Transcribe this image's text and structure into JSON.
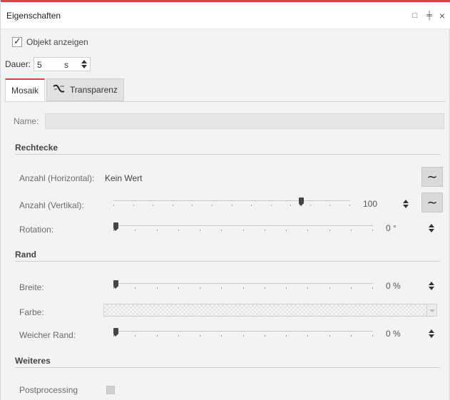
{
  "window": {
    "title": "Eigenschaften",
    "controls": [
      {
        "name": "maximize",
        "glyph": "□"
      },
      {
        "name": "pin",
        "glyph": "╪"
      },
      {
        "name": "close",
        "glyph": "×"
      }
    ]
  },
  "accent_color": "#d94545",
  "show_object": {
    "label": "Objekt anzeigen",
    "checked": true
  },
  "duration": {
    "label": "Dauer:",
    "value": "5",
    "unit": "s"
  },
  "tabs": [
    {
      "label": "Mosaik",
      "active": true,
      "icon": ""
    },
    {
      "label": "Transparenz",
      "active": false,
      "icon": "transparency-icon"
    }
  ],
  "name_field": {
    "label": "Name:",
    "value": ""
  },
  "sections": {
    "rechtecke": {
      "title": "Rechtecke",
      "horizontal": {
        "label": "Anzahl (Horizontal):",
        "value": "Kein Wert"
      },
      "vertical": {
        "label": "Anzahl (Vertikal):",
        "value": "100",
        "slider_fraction": 0.8
      },
      "rotation": {
        "label": "Rotation:",
        "value": "0 °",
        "slider_fraction": 0.0
      }
    },
    "rand": {
      "title": "Rand",
      "breite": {
        "label": "Breite:",
        "value": "0 %",
        "slider_fraction": 0.0
      },
      "farbe": {
        "label": "Farbe:"
      },
      "weicher_rand": {
        "label": "Weicher Rand:",
        "value": "0 %",
        "slider_fraction": 0.0
      }
    },
    "weiteres": {
      "title": "Weiteres",
      "postprocessing": {
        "label": "Postprocessing",
        "checked": false
      }
    }
  },
  "curve_button_glyph": "∼"
}
